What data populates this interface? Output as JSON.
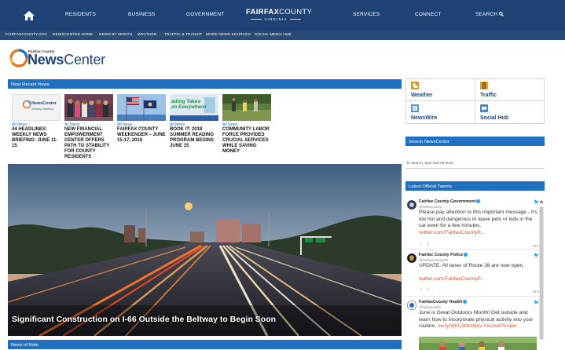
{
  "topnav": {
    "items": [
      "RESIDENTS",
      "BUSINESS",
      "GOVERNMENT",
      "SERVICES",
      "CONNECT",
      "SEARCH"
    ],
    "brand_bold": "FAIRFAX",
    "brand_light": "COUNTY",
    "brand_sub": "VIRGINIA",
    "home_icon": "home-icon",
    "search_icon": "search-icon"
  },
  "subnav": {
    "items": [
      "FAIRFAXCOUNTY.GOV",
      "NEWSCENTER HOME",
      "NEWS BY MONTH",
      "WEATHER",
      "TRAFFIC & TRANSIT",
      "MORE NEWS SOURCES",
      "SOCIAL MEDIA HUB"
    ]
  },
  "logo": {
    "small": "Fairfax County",
    "big_bold": "News",
    "big_rest": "Center"
  },
  "most_recent": {
    "header": "Most Recent News",
    "cards": [
      {
        "cat": "All News",
        "title": "44 HEADLINES: WEEKLY NEWS BRIEFING: JUNE 11-15",
        "thumb_a": "NewsCenter",
        "thumb_b": "Weekly Briefing"
      },
      {
        "cat": "All News",
        "title": "NEW FINANCIAL EMPOWERMENT CENTER OFFERS PATH TO STABILITY FOR COUNTY RESIDENTS"
      },
      {
        "cat": "All News",
        "title": "FAIRFAX COUNTY WEEKENDER – JUNE 15-17, 2018"
      },
      {
        "cat": "All News",
        "title": "BOOK IT: 2018 SUMMER READING PROGRAM BEGINS JUNE 15",
        "thumb_a": "ading Takes",
        "thumb_b": "on Everywhere!"
      },
      {
        "cat": "All News",
        "title": "COMMUNITY LABOR FORCE PROVIDES CRUCIAL SERVICES WHILE SAVING MONEY"
      }
    ]
  },
  "hero": {
    "caption": "Significant Construction on I-66 Outside the Beltway to Begin Soon"
  },
  "news_of_note": {
    "header": "News of Note"
  },
  "quicklinks": [
    {
      "label": "Weather",
      "icon": "weather-icon",
      "color": "#d49a2c"
    },
    {
      "label": "Traffic",
      "icon": "traffic-light-icon",
      "color": "#e0a51a"
    },
    {
      "label": "NewsWire",
      "icon": "newswire-icon",
      "color": "#5a8fd0"
    },
    {
      "label": "Social Hub",
      "icon": "social-hub-icon",
      "color": "#4a86c8"
    }
  ],
  "search": {
    "header": "Search NewsCenter",
    "placeholder": "To search, type and hit enter"
  },
  "tweets": {
    "header": "Latest Official Tweets",
    "items": [
      {
        "name": "Fairfax County Government",
        "handle": "@fairfaxcounty",
        "text": "Please pay attention to this important message - it's too hot and dangerous to leave pets or kids in the car even for a few minutes.",
        "link": "twitter.com/FairfaxCountyP...",
        "time": "29m"
      },
      {
        "name": "Fairfax County Police",
        "handle": "@FairfaxCountyPD",
        "text": "UPDATE: All lanes of Route 28 are now open.",
        "link": "twitter.com/FairfaxCountyP...",
        "time": "38m"
      },
      {
        "name": "FairfaxCounty Health",
        "handle": "@fairfaxhealth",
        "text": "June is Great Outdoors Month! Get outside and learn how to incorporate physical activity into your routine.",
        "link": "ow.ly/9jKU30kzbwv",
        "hashtag": "#ActivePeople"
      }
    ]
  },
  "colors": {
    "navy": "#1e4274",
    "section_blue": "#1f70c1",
    "link_orange": "#d9562e"
  }
}
